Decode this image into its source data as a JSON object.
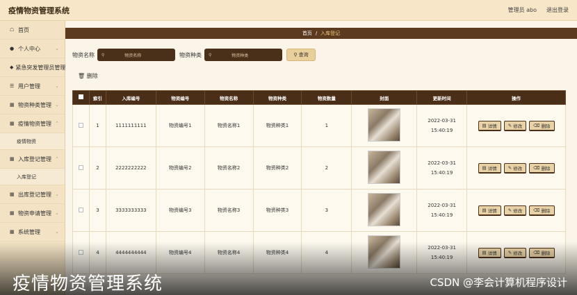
{
  "app": {
    "title": "疫情物资管理系统"
  },
  "topbar": {
    "admin_label": "管理员 abo",
    "logout_label": "退出登录"
  },
  "sidebar": {
    "items": [
      {
        "label": "首页",
        "icon": "home-icon"
      },
      {
        "label": "个人中心",
        "icon": "user-icon"
      },
      {
        "label": "紧急突发管理员管理",
        "icon": "shield-icon"
      },
      {
        "label": "用户管理",
        "icon": "list-icon"
      },
      {
        "label": "物资种类管理",
        "icon": "grid-icon"
      },
      {
        "label": "疫情物资管理",
        "icon": "grid-icon"
      },
      {
        "label": "疫情物资",
        "icon": ""
      },
      {
        "label": "入库登记管理",
        "icon": "grid-icon"
      },
      {
        "label": "入库登记",
        "icon": ""
      },
      {
        "label": "出库登记管理",
        "icon": "grid-icon"
      },
      {
        "label": "物资申请管理",
        "icon": "grid-icon"
      },
      {
        "label": "系统管理",
        "icon": "grid-icon"
      }
    ]
  },
  "breadcrumb": {
    "home": "首页",
    "current": "入库登记"
  },
  "search": {
    "name_label": "物资名称",
    "name_placeholder": "物资名称",
    "type_label": "物资种类",
    "type_placeholder": "物资种类",
    "query_label": "查询"
  },
  "toolbar": {
    "delete_label": "删除"
  },
  "table": {
    "headers": [
      "索引",
      "入库编号",
      "物资编号",
      "物资名称",
      "物资种类",
      "物资数量",
      "封面",
      "更新时间",
      "操作"
    ],
    "rows": [
      {
        "idx": "1",
        "in_no": "1111111111",
        "item_no": "物资编号1",
        "name": "物资名称1",
        "type": "物资种类1",
        "qty": "1",
        "time": "2022-03-31 15:40:19"
      },
      {
        "idx": "2",
        "in_no": "2222222222",
        "item_no": "物资编号2",
        "name": "物资名称2",
        "type": "物资种类2",
        "qty": "2",
        "time": "2022-03-31 15:40:19"
      },
      {
        "idx": "3",
        "in_no": "3333333333",
        "item_no": "物资编号3",
        "name": "物资名称3",
        "type": "物资种类3",
        "qty": "3",
        "time": "2022-03-31 15:40:19"
      },
      {
        "idx": "4",
        "in_no": "4444444444",
        "item_no": "物资编号4",
        "name": "物资名称4",
        "type": "物资种类4",
        "qty": "4",
        "time": "2022-03-31 15:40:19"
      }
    ],
    "actions": {
      "detail": "详情",
      "edit": "修改",
      "delete": "删除"
    }
  },
  "overlay": {
    "title": "疫情物资管理系统",
    "credit": "CSDN @李会计算机程序设计"
  }
}
